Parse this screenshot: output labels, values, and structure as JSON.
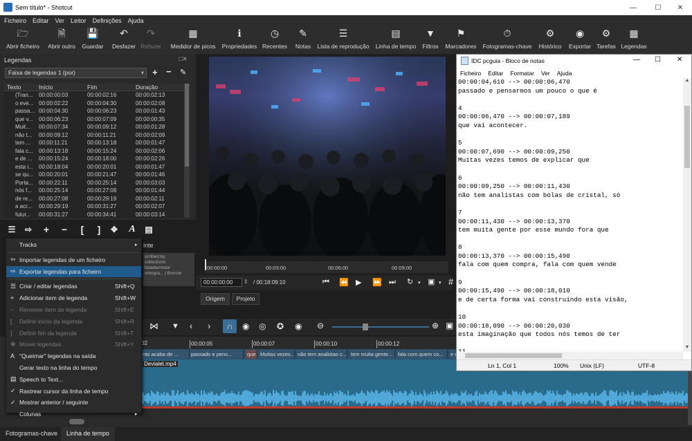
{
  "window": {
    "title": "Sem título* - Shotcut"
  },
  "menu": [
    "Ficheiro",
    "Editar",
    "Ver",
    "Leitor",
    "Definições",
    "Ajuda"
  ],
  "toolbar": [
    {
      "label": "Abrir ficheiro",
      "icon": "folder-icon",
      "enabled": true
    },
    {
      "label": "Abrir outro",
      "icon": "open-other-icon",
      "enabled": true
    },
    {
      "label": "Guardar",
      "icon": "save-icon",
      "enabled": true
    },
    {
      "label": "Desfazer",
      "icon": "undo-icon",
      "enabled": true
    },
    {
      "label": "Refazer",
      "icon": "redo-icon",
      "enabled": false
    },
    {
      "label": "Medidor de picos",
      "icon": "peak-meter-icon",
      "enabled": true
    },
    {
      "label": "Propriedades",
      "icon": "info-icon",
      "enabled": true
    },
    {
      "label": "Recentes",
      "icon": "clock-icon",
      "enabled": true
    },
    {
      "label": "Notas",
      "icon": "notes-icon",
      "enabled": true
    },
    {
      "label": "Lista de reprodução",
      "icon": "playlist-icon",
      "enabled": true
    },
    {
      "label": "Linha de tempo",
      "icon": "timeline-icon",
      "enabled": true
    },
    {
      "label": "Filtros",
      "icon": "filter-icon",
      "enabled": true
    },
    {
      "label": "Marcadores",
      "icon": "marker-icon",
      "enabled": true
    },
    {
      "label": "Fotogramas-chave",
      "icon": "keyframes-icon",
      "enabled": true
    },
    {
      "label": "Histórico",
      "icon": "history-icon",
      "enabled": true
    },
    {
      "label": "Exportar",
      "icon": "export-icon",
      "enabled": true
    },
    {
      "label": "Tarefas",
      "icon": "gear-icon",
      "enabled": true
    },
    {
      "label": "Legendas",
      "icon": "subtitles-icon",
      "enabled": true
    }
  ],
  "subtitles_panel": {
    "title": "Legendas",
    "track": "Faixa de legendas 1 (por)",
    "columns": [
      "Texto",
      "Início",
      "Fim",
      "Duração"
    ],
    "rows": [
      [
        "(Tran...",
        "00:00:00:03",
        "00:00:02:16",
        "00:00:02:13"
      ],
      [
        "o eve...",
        "00:00:02:22",
        "00:00:04:30",
        "00:00:02:08"
      ],
      [
        "passa...",
        "00:00:04:30",
        "00:00:06:23",
        "00:00:01:43"
      ],
      [
        "que v...",
        "00:00:06:23",
        "00:00:07:09",
        "00:00:00:35"
      ],
      [
        "Muit...",
        "00:00:07:34",
        "00:00:09:12",
        "00:00:01:28"
      ],
      [
        "não t...",
        "00:00:09:12",
        "00:00:11:21",
        "00:00:02:09"
      ],
      [
        "tem ...",
        "00:00:11:21",
        "00:00:13:18",
        "00:00:01:47"
      ],
      [
        "fala c...",
        "00:00:13:18",
        "00:00:15:24",
        "00:00:02:06"
      ],
      [
        "e de ...",
        "00:00:15:24",
        "00:00:18:00",
        "00:00:02:26"
      ],
      [
        "esta i...",
        "00:00:18:04",
        "00:00:20:01",
        "00:00:01:47"
      ],
      [
        "se qu...",
        "00:00:20:01",
        "00:00:21:47",
        "00:00:01:46"
      ],
      [
        "Porta...",
        "00:00:22:11",
        "00:00:25:14",
        "00:00:03:03"
      ],
      [
        "nós f...",
        "00:00:25:14",
        "00:00:27:08",
        "00:00:01:44"
      ],
      [
        "de re...",
        "00:00:27:08",
        "00:00:29:19",
        "00:00:02:11"
      ],
      [
        "a acr...",
        "00:00:29:19",
        "00:00:31:27",
        "00:00:02:07"
      ],
      [
        "futur...",
        "00:00:31:27",
        "00:00:34:41",
        "00:00:03:14"
      ],
      [
        "",
        "00:00:34:..",
        "00:00:36:..",
        "00:00:02:.."
      ]
    ]
  },
  "context_menu": [
    {
      "label": "Tracks",
      "shortcut": "",
      "submenu": true,
      "enabled": true
    },
    {
      "sep": true
    },
    {
      "label": "Importar legendas de um ficheiro",
      "shortcut": "",
      "enabled": true,
      "icon": "import-icon"
    },
    {
      "label": "Exportar legendas para ficheiro",
      "shortcut": "",
      "enabled": true,
      "selected": true,
      "icon": "export-icon"
    },
    {
      "sep": true
    },
    {
      "label": "Criar / editar legendas",
      "shortcut": "Shift+Q",
      "enabled": true,
      "icon": "list-icon"
    },
    {
      "label": "Adicionar item de legenda",
      "shortcut": "Shift+W",
      "enabled": true,
      "icon": "plus-icon"
    },
    {
      "label": "Remover item de legenda",
      "shortcut": "Shift+E",
      "enabled": false,
      "icon": "minus-icon"
    },
    {
      "label": "Definir início da legenda",
      "shortcut": "Shift+R",
      "enabled": false,
      "icon": "bracket-left-icon"
    },
    {
      "label": "Definir fim da legenda",
      "shortcut": "Shift+T",
      "enabled": false,
      "icon": "bracket-right-icon"
    },
    {
      "label": "Mover legendas",
      "shortcut": "Shift+Y",
      "enabled": false,
      "icon": "move-icon"
    },
    {
      "label": "\"Queimar\" legendas na saída",
      "shortcut": "",
      "enabled": true,
      "icon": "burn-icon"
    },
    {
      "label": "Gerar texto na linha do tempo",
      "shortcut": "",
      "enabled": true
    },
    {
      "label": "Speech to Text...",
      "shortcut": "",
      "enabled": true,
      "icon": "speech-icon"
    },
    {
      "label": "Rastrear cursor da linha de tempo",
      "shortcut": "",
      "enabled": true,
      "checked": true
    },
    {
      "label": "Mostrar anterior / seguinte",
      "shortcut": "",
      "enabled": true,
      "checked": true
    },
    {
      "label": "Colunas",
      "shortcut": "",
      "submenu": true,
      "enabled": true
    }
  ],
  "player": {
    "ruler_ticks": [
      "00:00:00",
      "00:03:00",
      "00:06:00",
      "00:09:00",
      "00:12:00"
    ],
    "timecode": "00:00:00:00",
    "duration": "/ 00:18:09:10",
    "tabs": [
      "Origem",
      "Projeto"
    ]
  },
  "timeline": {
    "ruler_ticks": [
      "00:00:05",
      "00:00:07",
      "00:00:10",
      "00:00:12"
    ],
    "ruler_first": "02",
    "subtitle_clips": [
      "nto acaba de ...",
      "passado e pens...",
      "que ...",
      "Muitas vezes...",
      "não tem analistas c...",
      "tem muita gente...",
      "fala com quem co...",
      "e de c"
    ],
    "video_clip": "Devialet.mp4"
  },
  "bottom_tabs": [
    "Fotogramas-chave",
    "Linha de tempo"
  ],
  "partial_labels": {
    "tint": "inte",
    "overlay": "scribed by\ncollections\nlistadarmstor\nontogra... | Borrow"
  },
  "notepad": {
    "title": "IDC pcguia - Bloco de notas",
    "menu": [
      "Ficheiro",
      "Editar",
      "Formatar",
      "Ver",
      "Ajuda"
    ],
    "lines": [
      "00:00:04,610 --> 00:00:06,470",
      "passado e pensarmos um pouco o que é",
      "",
      "4",
      "00:00:06,470 --> 00:00:07,189",
      "que vai acontecer.",
      "",
      "5",
      "00:00:07,690 --> 00:00:09,250",
      "Muitas vezes temos de explicar que",
      "",
      "6",
      "00:00:09,250 --> 00:00:11,430",
      "não tem analistas com bolas de cristal, só",
      "",
      "7",
      "00:00:11,430 --> 00:00:13,370",
      "tem muita gente por esse mundo fora que",
      "",
      "8",
      "00:00:13,370 --> 00:00:15,490",
      "fala com quem compra, fala com quem vende",
      "",
      "9",
      "00:00:15,490 --> 00:00:18,010",
      "e de certa forma vai construindo esta visão,",
      "",
      "10",
      "00:00:18,090 --> 00:00:20,030",
      "esta imaginação que todos nós temos de ter",
      "",
      "11"
    ],
    "status": {
      "position": "Ln 1, Col 1",
      "zoom": "100%",
      "eol": "Unix (LF)",
      "encoding": "UTF-8"
    }
  }
}
